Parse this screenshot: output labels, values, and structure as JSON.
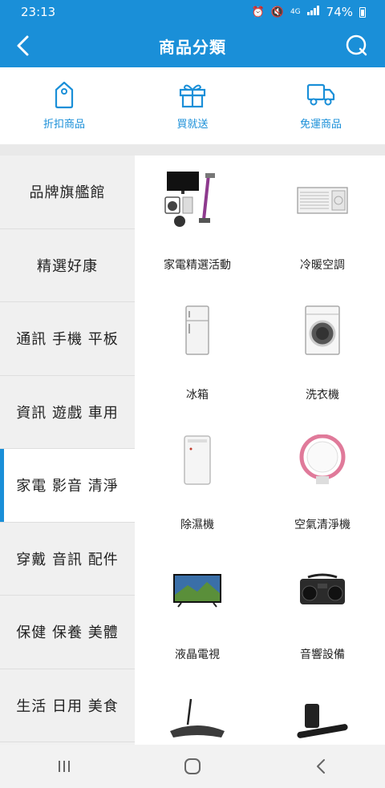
{
  "status": {
    "time": "23:13",
    "indicators": "4G",
    "battery": "74%"
  },
  "header": {
    "title": "商品分類",
    "back_icon": "chevron-left-icon",
    "search_icon": "search-icon"
  },
  "quick_links": [
    {
      "label": "折扣商品",
      "icon": "price-tag-icon"
    },
    {
      "label": "買就送",
      "icon": "gift-icon"
    },
    {
      "label": "免運商品",
      "icon": "truck-icon"
    }
  ],
  "sidebar": {
    "items": [
      {
        "label": "品牌旗艦館"
      },
      {
        "label": "精選好康"
      },
      {
        "label": "通訊 手機 平板"
      },
      {
        "label": "資訊 遊戲 車用"
      },
      {
        "label": "家電 影音 清淨",
        "active": true
      },
      {
        "label": "穿戴 音訊 配件"
      },
      {
        "label": "保健 保養 美體"
      },
      {
        "label": "生活 日用 美食"
      }
    ]
  },
  "products": [
    {
      "label": "家電精選活動",
      "icon": "appliance-bundle-icon"
    },
    {
      "label": "冷暖空調",
      "icon": "air-conditioner-icon"
    },
    {
      "label": "冰箱",
      "icon": "refrigerator-icon"
    },
    {
      "label": "洗衣機",
      "icon": "washing-machine-icon"
    },
    {
      "label": "除濕機",
      "icon": "dehumidifier-icon"
    },
    {
      "label": "空氣清淨機",
      "icon": "air-purifier-icon"
    },
    {
      "label": "液晶電視",
      "icon": "lcd-tv-icon"
    },
    {
      "label": "音響設備",
      "icon": "stereo-icon"
    },
    {
      "label": "",
      "icon": "router-icon"
    },
    {
      "label": "",
      "icon": "soundbar-icon"
    }
  ],
  "colors": {
    "brand": "#1a8fd8",
    "sidebar_bg": "#f0f0f0"
  },
  "navbar": {
    "recents_icon": "recents-icon",
    "home_icon": "home-icon",
    "back_icon": "back-icon"
  }
}
